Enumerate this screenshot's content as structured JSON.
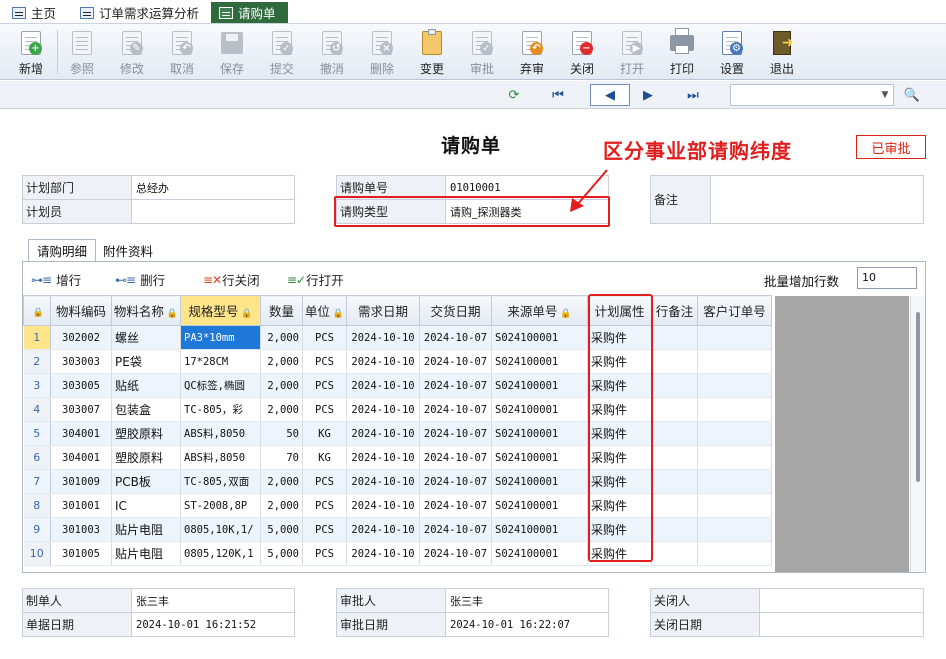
{
  "tabs": [
    {
      "label": "主页",
      "icon": "tree-icon",
      "active": false
    },
    {
      "label": "订单需求运算分析",
      "icon": "table-icon",
      "active": false
    },
    {
      "label": "请购单",
      "icon": "table-icon",
      "active": true
    }
  ],
  "toolbar": [
    {
      "key": "new",
      "label": "新增",
      "icon": "new-icon",
      "enabled": true
    },
    {
      "key": "ref",
      "label": "参照",
      "icon": "reference-icon",
      "enabled": false
    },
    {
      "key": "edit",
      "label": "修改",
      "icon": "edit-icon",
      "enabled": false
    },
    {
      "key": "cancel",
      "label": "取消",
      "icon": "undo-icon",
      "enabled": false
    },
    {
      "key": "save",
      "label": "保存",
      "icon": "save-icon",
      "enabled": false
    },
    {
      "key": "submit",
      "label": "提交",
      "icon": "submit-icon",
      "enabled": false
    },
    {
      "key": "withdraw",
      "label": "撤消",
      "icon": "withdraw-icon",
      "enabled": false
    },
    {
      "key": "delete",
      "label": "删除",
      "icon": "delete-icon",
      "enabled": false
    },
    {
      "key": "change",
      "label": "变更",
      "icon": "change-icon",
      "enabled": true
    },
    {
      "key": "approve",
      "label": "审批",
      "icon": "approve-icon",
      "enabled": false
    },
    {
      "key": "abandon",
      "label": "弃审",
      "icon": "abandon-approve-icon",
      "enabled": true
    },
    {
      "key": "close",
      "label": "关闭",
      "icon": "close-doc-icon",
      "enabled": true
    },
    {
      "key": "open",
      "label": "打开",
      "icon": "open-doc-icon",
      "enabled": false
    },
    {
      "key": "print",
      "label": "打印",
      "icon": "printer-icon",
      "enabled": true
    },
    {
      "key": "settings",
      "label": "设置",
      "icon": "settings-icon",
      "enabled": true
    },
    {
      "key": "exit",
      "label": "退出",
      "icon": "exit-icon",
      "enabled": true
    }
  ],
  "form": {
    "title": "请购单",
    "annotation": "区分事业部请购纬度",
    "status_stamp": "已审批",
    "plan_dept_label": "计划部门",
    "plan_dept_value": "总经办",
    "planner_label": "计划员",
    "planner_value": "",
    "order_no_label": "请购单号",
    "order_no_value": "01010001",
    "order_type_label": "请购类型",
    "order_type_value": "请购_探测器类",
    "remark_label": "备注",
    "remark_value": ""
  },
  "detail_tabs": [
    {
      "label": "请购明细",
      "active": true
    },
    {
      "label": "附件资料",
      "active": false
    }
  ],
  "subtoolbar": {
    "add_row": "增行",
    "del_row": "删行",
    "close_row": "行关闭",
    "open_row": "行打开",
    "batch_label": "批量增加行数",
    "batch_value": "10"
  },
  "grid": {
    "headers": [
      "物料编码",
      "物料名称",
      "规格型号",
      "数量",
      "单位",
      "需求日期",
      "交货日期",
      "来源单号",
      "计划属性",
      "行备注",
      "客户订单号"
    ],
    "rows": [
      [
        "1",
        "302002",
        "螺丝",
        "PA3*10mm",
        "2,000",
        "PCS",
        "2024-10-10",
        "2024-10-07",
        "S024100001",
        "采购件",
        "",
        ""
      ],
      [
        "2",
        "303003",
        "PE袋",
        "17*28CM",
        "2,000",
        "PCS",
        "2024-10-10",
        "2024-10-07",
        "S024100001",
        "采购件",
        "",
        ""
      ],
      [
        "3",
        "303005",
        "贴纸",
        "QC标签,椭圆",
        "2,000",
        "PCS",
        "2024-10-10",
        "2024-10-07",
        "S024100001",
        "采购件",
        "",
        ""
      ],
      [
        "4",
        "303007",
        "包装盒",
        "TC-805，彩",
        "2,000",
        "PCS",
        "2024-10-10",
        "2024-10-07",
        "S024100001",
        "采购件",
        "",
        ""
      ],
      [
        "5",
        "304001",
        "塑胶原料",
        "ABS料,8050",
        "50",
        "KG",
        "2024-10-10",
        "2024-10-07",
        "S024100001",
        "采购件",
        "",
        ""
      ],
      [
        "6",
        "304001",
        "塑胶原料",
        "ABS料,8050",
        "70",
        "KG",
        "2024-10-10",
        "2024-10-07",
        "S024100001",
        "采购件",
        "",
        ""
      ],
      [
        "7",
        "301009",
        "PCB板",
        "TC-805,双面",
        "2,000",
        "PCS",
        "2024-10-10",
        "2024-10-07",
        "S024100001",
        "采购件",
        "",
        ""
      ],
      [
        "8",
        "301001",
        "IC",
        "ST-2008,8P",
        "2,000",
        "PCS",
        "2024-10-10",
        "2024-10-07",
        "S024100001",
        "采购件",
        "",
        ""
      ],
      [
        "9",
        "301003",
        "贴片电阻",
        "0805,10K,1/",
        "5,000",
        "PCS",
        "2024-10-10",
        "2024-10-07",
        "S024100001",
        "采购件",
        "",
        ""
      ],
      [
        "10",
        "301005",
        "贴片电阻",
        "0805,120K,1",
        "5,000",
        "PCS",
        "2024-10-10",
        "2024-10-07",
        "S024100001",
        "采购件",
        "",
        ""
      ]
    ]
  },
  "footer": {
    "creator_label": "制单人",
    "creator_value": "张三丰",
    "doc_date_label": "单据日期",
    "doc_date_value": "2024-10-01 16:21:52",
    "approver_label": "审批人",
    "approver_value": "张三丰",
    "approve_date_label": "审批日期",
    "approve_date_value": "2024-10-01 16:22:07",
    "closer_label": "关闭人",
    "closer_value": "",
    "close_date_label": "关闭日期",
    "close_date_value": ""
  },
  "colors": {
    "accent_red": "#e11d1d",
    "tab_active": "#2f6a3c",
    "selection": "#1e78d7",
    "header_highlight": "#ffe58a"
  }
}
